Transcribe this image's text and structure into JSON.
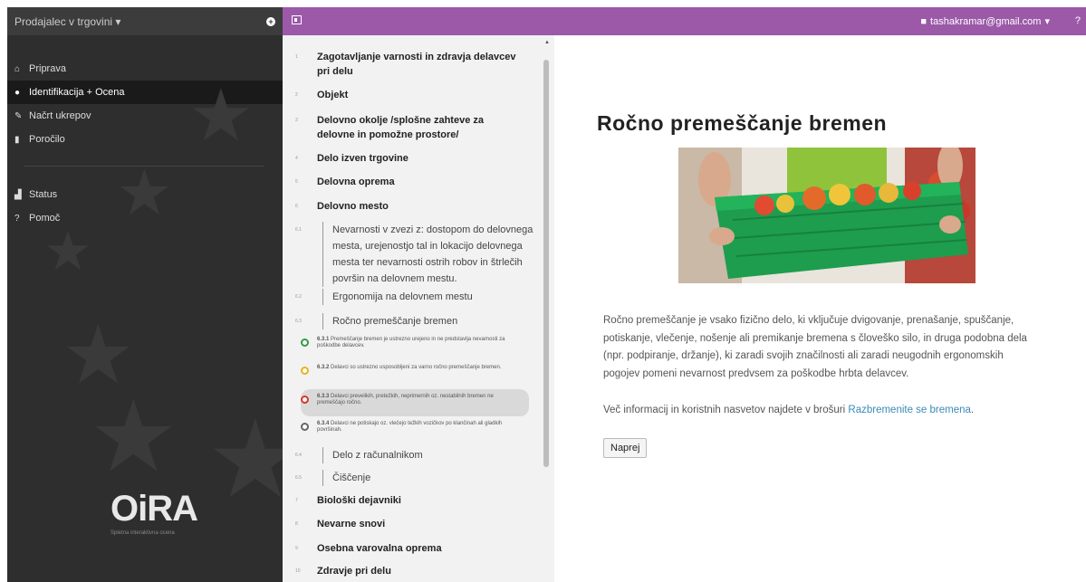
{
  "sidebar": {
    "header": {
      "title": "Prodajalec v trgovini",
      "caret": "▾",
      "plus": "+"
    },
    "items": [
      {
        "icon": "home-icon",
        "glyph": "⌂",
        "label": "Priprava"
      },
      {
        "icon": "record-icon",
        "glyph": "●",
        "label": "Identifikacija + Ocena"
      },
      {
        "icon": "pencil-icon",
        "glyph": "✎",
        "label": "Načrt ukrepov"
      },
      {
        "icon": "document-icon",
        "glyph": "▮",
        "label": "Poročilo"
      }
    ],
    "items2": [
      {
        "icon": "bar-chart-icon",
        "glyph": "▟",
        "label": "Status"
      },
      {
        "icon": "question-icon",
        "glyph": "?",
        "label": "Pomoč"
      }
    ],
    "logo": "OiRA",
    "logo_sub": "Spletna interaktivna ocena"
  },
  "topbar": {
    "user_email": "tashakramar@gmail.com",
    "caret": "▾",
    "help": "?"
  },
  "tree": {
    "scroll_up": "▲",
    "rows": [
      {
        "num": "1",
        "level": 1,
        "text": "Zagotavljanje varnosti in zdravja delavcev pri delu"
      },
      {
        "num": "2",
        "level": 1,
        "text": "Objekt"
      },
      {
        "num": "3",
        "level": 1,
        "text": "Delovno okolje /splošne zahteve za delovne in pomožne prostore/"
      },
      {
        "num": "4",
        "level": 1,
        "text": "Delo izven trgovine"
      },
      {
        "num": "5",
        "level": 1,
        "text": "Delovna oprema"
      },
      {
        "num": "6",
        "level": 1,
        "text": "Delovno mesto"
      },
      {
        "num": "6.1",
        "level": 2,
        "text": "Nevarnosti v zvezi z: dostopom do delovnega mesta, urejenostjo tal in lokacijo delovnega mesta ter nevarnosti ostrih robov in štrlečih površin na delovnem mestu."
      },
      {
        "num": "6.2",
        "level": 2,
        "text": "Ergonomija na delovnem mestu"
      },
      {
        "num": "6.3",
        "level": 2,
        "text": "Ročno premeščanje bremen"
      },
      {
        "num": "6.4",
        "level": 2,
        "text": "Delo z računalnikom"
      },
      {
        "num": "6.5",
        "level": 2,
        "text": "Čiščenje"
      },
      {
        "num": "7",
        "level": 1,
        "text": "Biološki dejavniki"
      },
      {
        "num": "8",
        "level": 1,
        "text": "Nevarne snovi"
      },
      {
        "num": "9",
        "level": 1,
        "text": "Osebna varovalna oprema"
      },
      {
        "num": "10",
        "level": 1,
        "text": "Zdravje pri delu"
      }
    ],
    "questions": [
      {
        "num": "6.3.1",
        "text": "Premeščanje bremen je ustrezno urejeno in ne predstavlja nevarnosti za poškodbe delavcev.",
        "status_color": "#2e9e3f"
      },
      {
        "num": "6.3.2",
        "text": "Delavci so ustrezno usposobljeni za varno ročno premeščanje bremen.",
        "status_color": "#e7b41d"
      },
      {
        "num": "6.3.3",
        "text": "Delavci prevelikih, pretežkih, neprimernih oz. nestabilnih bremen ne premeščajo ročno.",
        "status_color": "#d9342b"
      },
      {
        "num": "6.3.4",
        "text": "Delavci ne potiskajo oz. vlečejo težkih vozičkov po klančinah ali gladkih površinah.",
        "status_color": "#666666"
      }
    ]
  },
  "main": {
    "title": "Ročno premeščanje bremen",
    "paragraph": "Ročno premeščanje je vsako fizično delo, ki vključuje dvigovanje, prenašanje, spuščanje, potiskanje, vlečenje, nošenje ali premikanje bremena s človeško silo, in druga podobna dela (npr. podpiranje, držanje), ki zaradi svojih značilnosti ali zaradi neugodnih ergonomskih pogojev pomeni nevarnost predvsem za poškodbe hrbta delavcev.",
    "more_prefix": "Več informacij in koristnih nasvetov najdete v brošuri ",
    "more_link": "Razbremenite se bremena",
    "more_suffix": ".",
    "next_button": "Naprej"
  },
  "colors": {
    "accent": "#9b59a8",
    "sidebar_bg": "#2e2e2e",
    "link": "#3a8bb5"
  }
}
